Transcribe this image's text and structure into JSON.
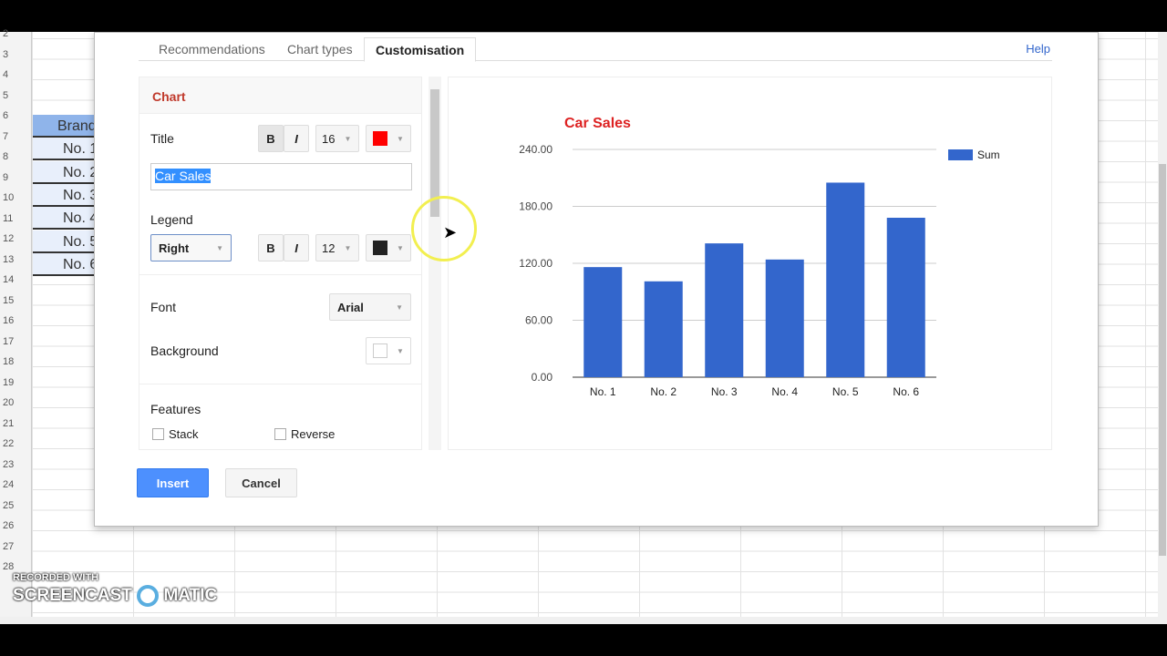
{
  "sheet": {
    "rows": [
      "2",
      "3",
      "4",
      "5",
      "6",
      "7",
      "8",
      "9",
      "10",
      "11",
      "12",
      "13",
      "14",
      "15",
      "16",
      "17",
      "18",
      "19",
      "20",
      "21",
      "22",
      "23",
      "24",
      "25",
      "26",
      "27",
      "28"
    ],
    "cells": [
      "Brand",
      "No. 1",
      "No. 2",
      "No. 3",
      "No. 4",
      "No. 5",
      "No. 6"
    ]
  },
  "dialog": {
    "tabs": [
      "Recommendations",
      "Chart types",
      "Customisation"
    ],
    "help": "Help",
    "section": "Chart",
    "title_label": "Title",
    "title_bold": "B",
    "title_italic": "I",
    "title_size": "16",
    "title_value": "Car Sales",
    "title_color": "#ff0000",
    "legend_label": "Legend",
    "legend_position": "Right",
    "legend_bold": "B",
    "legend_italic": "I",
    "legend_size": "12",
    "legend_color": "#222222",
    "font_label": "Font",
    "font_value": "Arial",
    "background_label": "Background",
    "features_label": "Features",
    "stack": "Stack",
    "reverse": "Reverse",
    "insert": "Insert",
    "cancel": "Cancel"
  },
  "chart_data": {
    "type": "bar",
    "title": "Car Sales",
    "categories": [
      "No. 1",
      "No. 2",
      "No. 3",
      "No. 4",
      "No. 5",
      "No. 6"
    ],
    "series": [
      {
        "name": "Sum",
        "values": [
          116,
          101,
          141,
          124,
          205,
          168
        ]
      }
    ],
    "yticks": [
      "0.00",
      "60.00",
      "120.00",
      "180.00",
      "240.00"
    ],
    "ylim": [
      0,
      240
    ],
    "legend": "right",
    "color": "#3366cc",
    "title_color": "#dd2222"
  },
  "watermark": {
    "line1": "RECORDED WITH",
    "line2": "SCREENCAST",
    "line3": "MATIC"
  }
}
